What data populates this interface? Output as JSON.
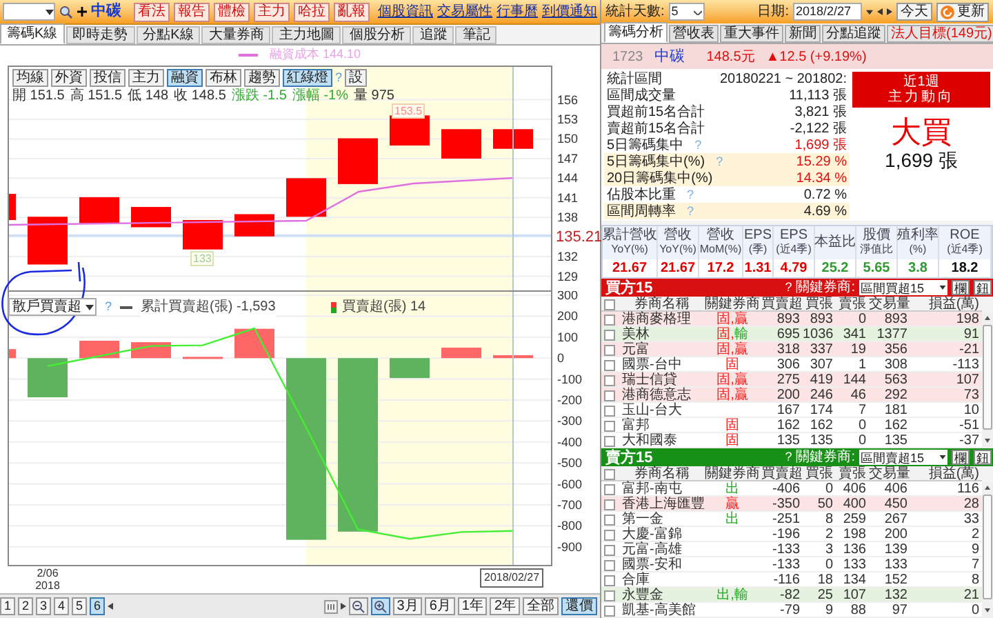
{
  "left": {
    "stock_name": "中碳",
    "action_buttons": [
      "看法",
      "報告",
      "體檢",
      "主力",
      "哈拉",
      "亂報"
    ],
    "links": [
      "個股資訊",
      "交易屬性",
      "行事曆",
      "到價通知"
    ],
    "tabs": [
      {
        "label": "籌碼K線",
        "selected": true
      },
      {
        "label": "即時走勢",
        "selected": false
      },
      {
        "label": "分點K線",
        "selected": false
      },
      {
        "label": "大量券商",
        "selected": false
      },
      {
        "label": "主力地圖",
        "selected": false
      },
      {
        "label": "個股分析",
        "selected": false
      },
      {
        "label": "追蹤",
        "selected": false
      },
      {
        "label": "筆記",
        "selected": false
      }
    ],
    "cost_legend": "融資成本 144.10",
    "indicator_buttons": [
      {
        "label": "均線",
        "selected": false
      },
      {
        "label": "外資",
        "selected": false
      },
      {
        "label": "投信",
        "selected": false
      },
      {
        "label": "主力",
        "selected": false
      },
      {
        "label": "融資",
        "selected": true
      },
      {
        "label": "布林",
        "selected": false
      },
      {
        "label": "趨勢",
        "selected": false
      },
      {
        "label": "紅綠燈",
        "selected": true
      }
    ],
    "indicator_help": "?",
    "settings_button": "設",
    "ohlc": [
      {
        "label": "開",
        "value": "151.5",
        "color": "#333333"
      },
      {
        "label": "高",
        "value": "151.5",
        "color": "#333333"
      },
      {
        "label": "低",
        "value": "148",
        "color": "#333333"
      },
      {
        "label": "收",
        "value": "148.5",
        "color": "#333333"
      },
      {
        "label": "漲跌",
        "value": "-1.5",
        "color": "#33aa33"
      },
      {
        "label": "漲幅",
        "value": "-1%",
        "color": "#33aa33"
      },
      {
        "label": "量",
        "value": "975",
        "color": "#333333"
      }
    ],
    "price_axis": [
      "156",
      "153",
      "150",
      "147",
      "144",
      "141",
      "138",
      "132",
      "129"
    ],
    "last_price_label": "135.21",
    "high_label": "153.5",
    "low_label": "133",
    "flow_select": "散戶買賣超",
    "flow_help": "?",
    "flow_line_total": "-1,593",
    "flow_bar_value": "14",
    "flow_chart": {
      "chart_data": {
        "type": "bar",
        "grid": true,
        "categories": [
          null,
          "2/06 2018",
          null,
          null,
          null,
          null,
          null,
          null,
          null,
          null,
          "2018/02/27"
        ],
        "series": [
          {
            "name": "買賣超(張)",
            "type": "bar",
            "color": "#ff6666",
            "values": [
              43,
              null,
              83,
              76,
              6,
              140,
              null,
              null,
              null,
              50,
              14
            ]
          },
          {
            "type": "bar",
            "color": "#5fb35f",
            "values": [
              null,
              -187,
              null,
              null,
              null,
              null,
              -867,
              -828,
              -95,
              null,
              null
            ]
          },
          {
            "name": "累計買賣超(張)",
            "type": "line",
            "color": "#44ee33",
            "values": [
              null,
              -38,
              10,
              58,
              61,
              142,
              -331,
              -817,
              -862,
              -830,
              -825
            ]
          }
        ],
        "ylim": [
          -990,
          320
        ],
        "yticks": [
          300,
          200,
          100,
          0,
          -100,
          -200,
          -300,
          -400,
          -500,
          -600,
          -700,
          -800,
          -900
        ]
      }
    },
    "pages": [
      {
        "label": "1",
        "selected": false
      },
      {
        "label": "2",
        "selected": false
      },
      {
        "label": "3",
        "selected": false
      },
      {
        "label": "4",
        "selected": false
      },
      {
        "label": "5",
        "selected": false
      },
      {
        "label": "6",
        "selected": true
      }
    ],
    "ranges": [
      {
        "label": "3月",
        "selected": false
      },
      {
        "label": "6月",
        "selected": false
      },
      {
        "label": "1年",
        "selected": false
      },
      {
        "label": "2年",
        "selected": false
      },
      {
        "label": "全部",
        "selected": false
      },
      {
        "label": "還價",
        "selected": true
      }
    ]
  },
  "right": {
    "days_label": "統計天數:",
    "days_value": "5",
    "date_label": "日期:",
    "date_value": "2018/2/27",
    "today_button": "今天",
    "refresh_button": "更新",
    "tabs": [
      {
        "label": "籌碼分析",
        "selected": true,
        "alert": false
      },
      {
        "label": "營收表",
        "selected": false,
        "alert": false
      },
      {
        "label": "重大事件",
        "selected": false,
        "alert": false
      },
      {
        "label": "新聞",
        "selected": false,
        "alert": false
      },
      {
        "label": "分點追蹤",
        "selected": false,
        "alert": false
      },
      {
        "label": "法人目標(149元)",
        "selected": false,
        "alert": true
      }
    ],
    "quote": {
      "code": "1723",
      "name": "中碳",
      "price": "148.5元",
      "change": "▲12.5 (+9.19%)"
    },
    "stats": [
      {
        "label": "統計區間",
        "value": "20180221 ~ 201802:",
        "highlight": false,
        "alert": false
      },
      {
        "label": "區間成交量",
        "value": "11,113 張",
        "highlight": false,
        "alert": false
      },
      {
        "label": "買超前15名合計",
        "value": "3,821 張",
        "highlight": false,
        "alert": false
      },
      {
        "label": "賣超前15名合計",
        "value": "-2,122 張",
        "highlight": false,
        "alert": false
      },
      {
        "label": "5日籌碼集中",
        "help": "?",
        "value": "1,699 張",
        "highlight": false,
        "alert": true
      },
      {
        "label": "5日籌碼集中(%)",
        "help": "?",
        "value": "15.29 %",
        "highlight": true,
        "alert": true
      },
      {
        "label": "20日籌碼集中(%)",
        "value": "14.34 %",
        "highlight": true,
        "alert": true
      },
      {
        "label": "佔股本比重",
        "help": "?",
        "value": "0.72 %",
        "highlight": false,
        "alert": false
      },
      {
        "label": "區間周轉率",
        "help": "?",
        "value": "4.69 %",
        "highlight": true,
        "alert": false
      }
    ],
    "trend": {
      "title": "近1週",
      "subtitle": "主力動向",
      "verdict": "大買",
      "amount": "1,699 張"
    },
    "fundamentals": [
      {
        "label": "累計營收",
        "sub": "YoY(%)",
        "value": "21.67",
        "color": "#e00000"
      },
      {
        "label": "營收",
        "sub": "YoY(%)",
        "value": "21.67",
        "color": "#e00000"
      },
      {
        "label": "營收",
        "sub": "MoM(%)",
        "value": "17.2",
        "color": "#e00000"
      },
      {
        "label": "EPS",
        "sub": "(季)",
        "value": "1.31",
        "color": "#e00000"
      },
      {
        "label": "EPS",
        "sub": "(近4季)",
        "value": "4.79",
        "color": "#e00000"
      },
      {
        "label": "本益比",
        "value": "25.2",
        "color": "#339933"
      },
      {
        "label": "股價",
        "sub": "淨值比",
        "value": "5.65",
        "color": "#339933"
      },
      {
        "label": "殖利率",
        "sub": "(%)",
        "value": "3.8",
        "color": "#339933"
      },
      {
        "label": "ROE",
        "sub": "(近4季)",
        "value": "18.2",
        "color": "#111111"
      }
    ],
    "tables": [
      {
        "color": "#d81010",
        "title": "買方15",
        "help": "?",
        "key_label": "關鍵券商:",
        "select": "區間買超15",
        "buttons": [
          "欄",
          "鈕"
        ],
        "all_checked": false,
        "columns": [
          "券商名稱",
          "關鍵券商",
          "買賣超",
          "買張",
          "賣張",
          "交易量",
          "損益(萬)"
        ],
        "rows": [
          {
            "checked": false,
            "color": "#fde4e4",
            "cells": [
              "港商麥格理",
              {
                "parts": [
                  {
                    "text": "固,",
                    "color": "#ff2020"
                  },
                  {
                    "text": "贏",
                    "color": "#ff2020"
                  }
                ]
              },
              "893",
              "893",
              "0",
              "893",
              "198"
            ]
          },
          {
            "checked": false,
            "color": "#e4f2df",
            "cells": [
              "美林",
              {
                "parts": [
                  {
                    "text": "固,",
                    "color": "#ff2020"
                  },
                  {
                    "text": "輸",
                    "color": "#22aa22"
                  }
                ]
              },
              "695",
              "1036",
              "341",
              "1377",
              "91"
            ]
          },
          {
            "checked": false,
            "color": "#fde4e4",
            "cells": [
              "元富",
              {
                "parts": [
                  {
                    "text": "固,",
                    "color": "#ff2020"
                  },
                  {
                    "text": "贏",
                    "color": "#ff2020"
                  }
                ]
              },
              "318",
              "337",
              "19",
              "356",
              "-21"
            ]
          },
          {
            "checked": false,
            "color": "#ffffff",
            "cells": [
              "國票-台中",
              {
                "parts": [
                  {
                    "text": "固",
                    "color": "#ff2020"
                  }
                ]
              },
              "306",
              "307",
              "1",
              "308",
              "-113"
            ]
          },
          {
            "checked": false,
            "color": "#fde4e4",
            "cells": [
              "瑞士信貸",
              {
                "parts": [
                  {
                    "text": "固,",
                    "color": "#ff2020"
                  },
                  {
                    "text": "贏",
                    "color": "#ff2020"
                  }
                ]
              },
              "275",
              "419",
              "144",
              "563",
              "107"
            ]
          },
          {
            "checked": false,
            "color": "#fde4e4",
            "cells": [
              "港商德意志",
              {
                "parts": [
                  {
                    "text": "固,",
                    "color": "#ff2020"
                  },
                  {
                    "text": "贏",
                    "color": "#ff2020"
                  }
                ]
              },
              "200",
              "246",
              "46",
              "292",
              "73"
            ]
          },
          {
            "checked": false,
            "color": "#ffffff",
            "cells": [
              "玉山-台大",
              "",
              "167",
              "174",
              "7",
              "181",
              "10"
            ]
          },
          {
            "checked": false,
            "color": "#ffffff",
            "cells": [
              "富邦",
              {
                "parts": [
                  {
                    "text": "固",
                    "color": "#ff2020"
                  }
                ]
              },
              "162",
              "162",
              "0",
              "162",
              "-51"
            ]
          },
          {
            "checked": false,
            "color": "#ffffff",
            "cells": [
              "大和國泰",
              {
                "parts": [
                  {
                    "text": "固",
                    "color": "#ff2020"
                  }
                ]
              },
              "135",
              "135",
              "0",
              "135",
              "-37"
            ]
          }
        ]
      },
      {
        "color": "#189018",
        "title": "賣方15",
        "help": "?",
        "key_label": "關鍵券商:",
        "select": "區間賣超15",
        "buttons": [
          "欄",
          "鈕"
        ],
        "all_checked": false,
        "columns": [
          "券商名稱",
          "關鍵券商",
          "買賣超",
          "買張",
          "賣張",
          "交易量",
          "損益(萬)"
        ],
        "rows": [
          {
            "checked": false,
            "color": "#ffffff",
            "cells": [
              "富邦-南屯",
              {
                "parts": [
                  {
                    "text": "出",
                    "color": "#22aa22"
                  }
                ]
              },
              "-406",
              "0",
              "406",
              "406",
              "116"
            ]
          },
          {
            "checked": false,
            "color": "#fde4e4",
            "cells": [
              "香港上海匯豐",
              {
                "parts": [
                  {
                    "text": "贏",
                    "color": "#ff2020"
                  }
                ]
              },
              "-350",
              "50",
              "400",
              "450",
              "28"
            ]
          },
          {
            "checked": false,
            "color": "#ffffff",
            "cells": [
              "第一金",
              {
                "parts": [
                  {
                    "text": "出",
                    "color": "#22aa22"
                  }
                ]
              },
              "-251",
              "8",
              "259",
              "267",
              "33"
            ]
          },
          {
            "checked": false,
            "color": "#ffffff",
            "cells": [
              "大慶-富錦",
              "",
              "-196",
              "2",
              "198",
              "200",
              "2"
            ]
          },
          {
            "checked": false,
            "color": "#ffffff",
            "cells": [
              "元富-高雄",
              "",
              "-133",
              "3",
              "136",
              "139",
              "9"
            ]
          },
          {
            "checked": false,
            "color": "#ffffff",
            "cells": [
              "國票-安和",
              "",
              "-133",
              "0",
              "133",
              "133",
              "7"
            ]
          },
          {
            "checked": false,
            "color": "#ffffff",
            "cells": [
              "合庫",
              "",
              "-116",
              "18",
              "134",
              "152",
              "8"
            ]
          },
          {
            "checked": false,
            "color": "#e4f2df",
            "cells": [
              "永豐金",
              {
                "parts": [
                  {
                    "text": "出,",
                    "color": "#22aa22"
                  },
                  {
                    "text": "輸",
                    "color": "#22aa22"
                  }
                ]
              },
              "-82",
              "25",
              "107",
              "132",
              "21"
            ]
          },
          {
            "checked": false,
            "color": "#ffffff",
            "cells": [
              "凱基-高美館",
              "",
              "-79",
              "9",
              "88",
              "97",
              "0"
            ]
          }
        ]
      }
    ]
  }
}
